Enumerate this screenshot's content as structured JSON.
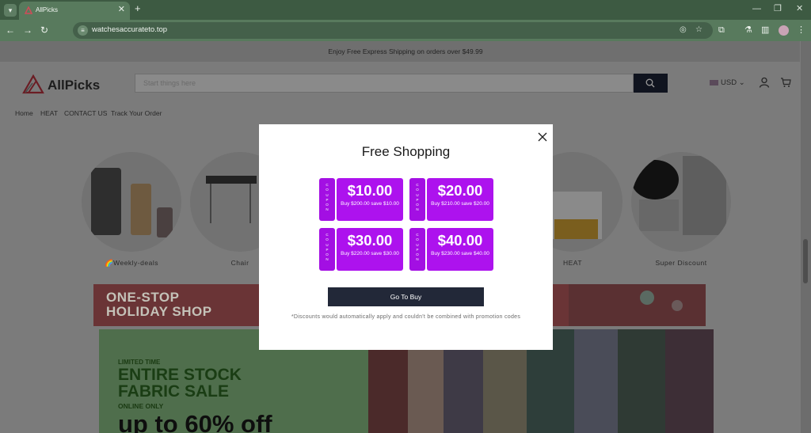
{
  "browser": {
    "tab_title": "AllPicks",
    "url": "watchesaccurateto.top"
  },
  "site": {
    "announcement": "Enjoy Free Express Shipping on orders over $49.99",
    "logo_text": "AllPicks",
    "search_placeholder": "Start things here",
    "currency": "USD",
    "menu": [
      "Home",
      "HEAT",
      "CONTACT US",
      "Track Your Order"
    ],
    "categories": [
      "🌈Weekly-deals",
      "Chair",
      "HEAT",
      "Super Discount"
    ],
    "banner1_text": "ONE-STOP HOLIDAY SHOP",
    "banner2": {
      "limited": "LIMITED TIME",
      "title_line1": "ENTIRE STOCK",
      "title_line2": "FABRIC SALE",
      "online": "ONLINE ONLY",
      "offer": "up to 60% off"
    }
  },
  "modal": {
    "title": "Free Shopping",
    "coupon_side_label": "COUPON",
    "coupons": [
      {
        "amount": "$10.00",
        "desc": "Buy $200.00 save $10.00"
      },
      {
        "amount": "$20.00",
        "desc": "Buy $210.00 save $20.00"
      },
      {
        "amount": "$30.00",
        "desc": "Buy $220.00 save $30.00"
      },
      {
        "amount": "$40.00",
        "desc": "Buy $230.00 save $40.00"
      }
    ],
    "button_label": "Go To Buy",
    "disclaimer": "*Discounts would automatically apply and couldn't be combined with promotion codes"
  },
  "colors": {
    "coupon_purple": "#ad12ee",
    "button_navy": "#222838",
    "browser_green": "#587a5d"
  }
}
